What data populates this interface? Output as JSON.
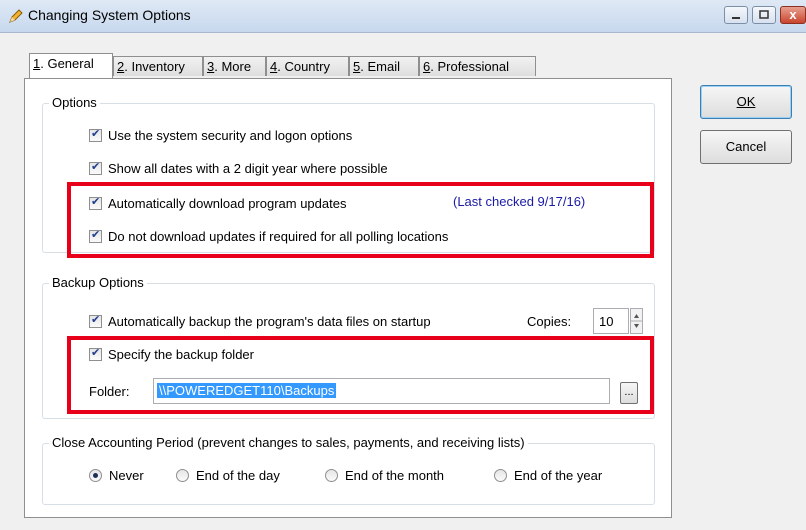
{
  "window": {
    "title": "Changing System Options",
    "close_glyph": "x"
  },
  "tabs": [
    {
      "label": "1. General",
      "key": "1",
      "rest": ". General"
    },
    {
      "label": "2. Inventory",
      "key": "2",
      "rest": ". Inventory"
    },
    {
      "label": "3. More",
      "key": "3",
      "rest": ". More"
    },
    {
      "label": "4. Country",
      "key": "4",
      "rest": ". Country"
    },
    {
      "label": "5. Email",
      "key": "5",
      "rest": ". Email"
    },
    {
      "label": "6. Professional",
      "key": "6",
      "rest": ". Professional"
    }
  ],
  "options": {
    "legend": "Options",
    "security": "Use the system security and logon options",
    "dates": "Show all dates with a 2 digit year where possible",
    "auto_download": "Automatically download program updates",
    "last_checked": "(Last checked 9/17/16)",
    "no_download": "Do not download updates if required for all polling locations"
  },
  "backup": {
    "legend": "Backup Options",
    "auto_backup": "Automatically backup the program's data files on startup",
    "copies_label": "Copies:",
    "copies_value": "10",
    "specify_folder": "Specify the backup folder",
    "folder_label": "Folder:",
    "folder_value": "\\\\POWEREDGET110\\Backups",
    "browse": "..."
  },
  "close_period": {
    "legend": "Close Accounting Period  (prevent changes to sales, payments, and receiving lists)",
    "options": [
      "Never",
      "End of the day",
      "End of the month",
      "End of the year"
    ],
    "selected": "Never"
  },
  "buttons": {
    "ok": "OK",
    "cancel": "Cancel"
  },
  "colors": {
    "highlight_red": "#e8001b",
    "link_blue": "#1a1aa6"
  }
}
